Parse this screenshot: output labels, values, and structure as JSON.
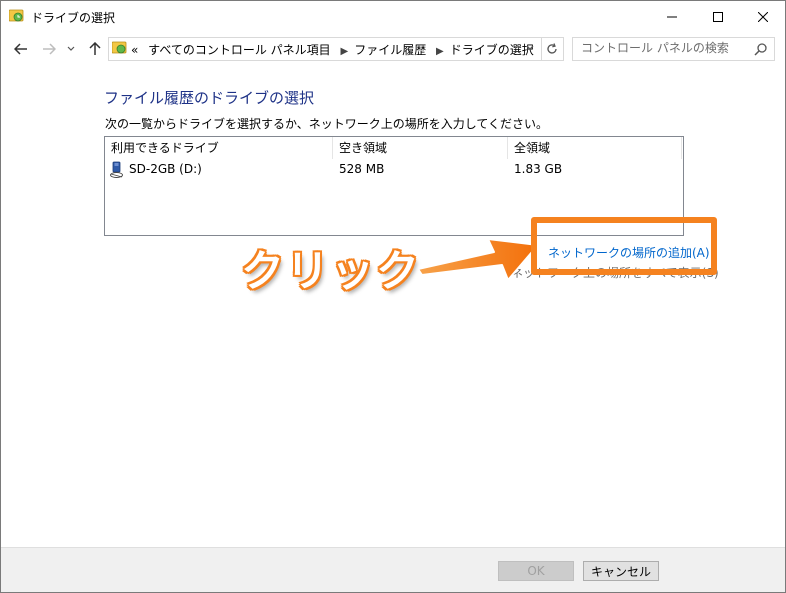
{
  "window": {
    "title": "ドライブの選択"
  },
  "nav": {
    "prefix": "«",
    "breadcrumbs": [
      "すべてのコントロール パネル項目",
      "ファイル履歴",
      "ドライブの選択"
    ],
    "search_placeholder": "コントロール パネルの検索"
  },
  "content": {
    "heading": "ファイル履歴のドライブの選択",
    "instruction": "次の一覧からドライブを選択するか、ネットワーク上の場所を入力してください。",
    "columns": [
      "利用できるドライブ",
      "空き領域",
      "全領域"
    ],
    "drives": [
      {
        "name": "SD-2GB (D:)",
        "free": "528 MB",
        "total": "1.83 GB"
      }
    ],
    "add_network_link": "ネットワークの場所の追加(A)",
    "show_all_link": "ネットワーク上の場所をすべて表示(S)"
  },
  "annotation": {
    "label": "クリック",
    "color": "#f5821f"
  },
  "footer": {
    "ok_label": "OK",
    "cancel_label": "キャンセル"
  }
}
